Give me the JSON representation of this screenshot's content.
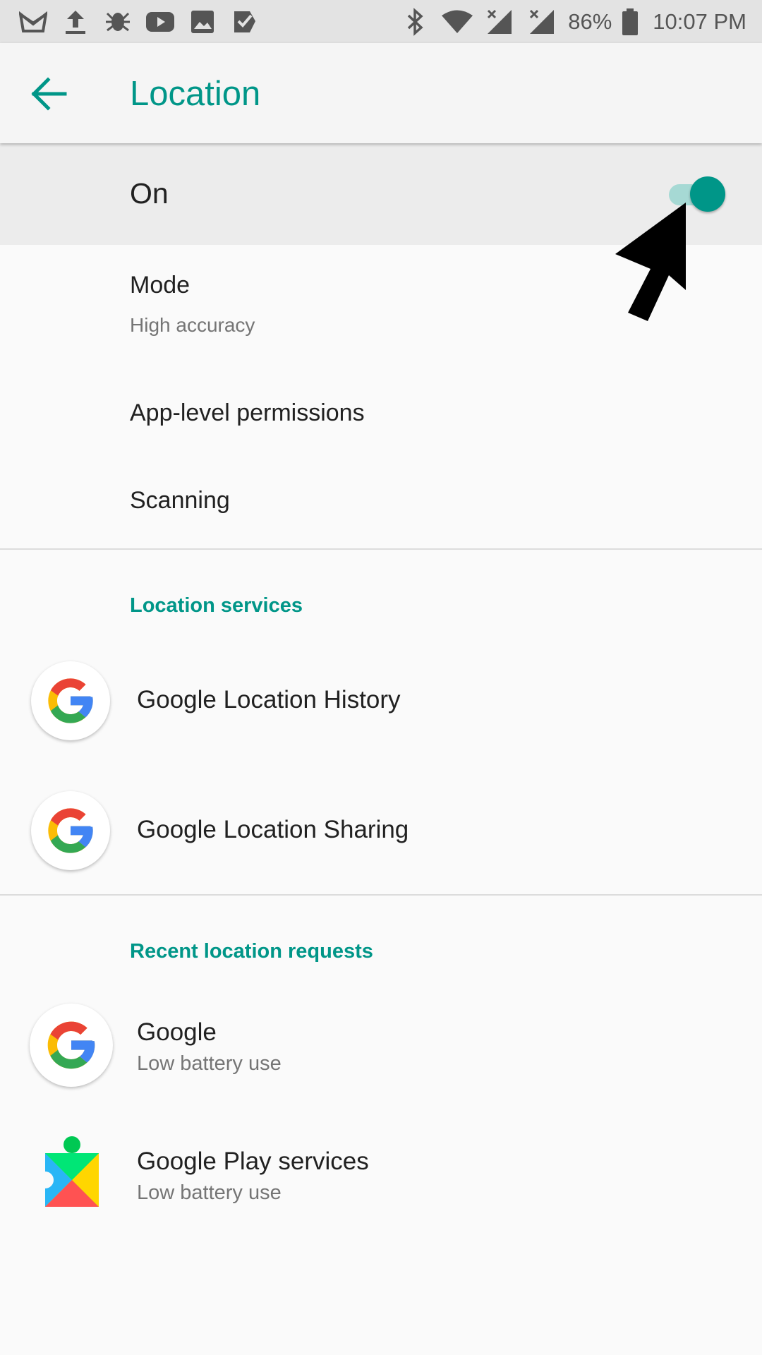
{
  "status_bar": {
    "left_icons": [
      "mail-icon",
      "upload-icon",
      "spider-icon",
      "youtube-icon",
      "image-icon",
      "tasks-icon"
    ],
    "right_icons": [
      "bluetooth-icon",
      "wifi-icon",
      "signal-icon",
      "signal-icon",
      "battery-icon"
    ],
    "battery": "86%",
    "time": "10:07 PM"
  },
  "app_bar": {
    "title": "Location",
    "back_icon": "arrow-back-icon"
  },
  "master": {
    "label": "On",
    "state": true
  },
  "settings": [
    {
      "title": "Mode",
      "subtitle": "High accuracy"
    },
    {
      "title": "App-level permissions"
    },
    {
      "title": "Scanning"
    }
  ],
  "location_services": {
    "header": "Location services",
    "items": [
      {
        "title": "Google Location History",
        "icon": "google-icon"
      },
      {
        "title": "Google Location Sharing",
        "icon": "google-icon"
      }
    ]
  },
  "recent_requests": {
    "header": "Recent location requests",
    "items": [
      {
        "title": "Google",
        "subtitle": "Low battery use",
        "icon": "google-icon"
      },
      {
        "title": "Google Play services",
        "subtitle": "Low battery use",
        "icon": "play-services-icon"
      }
    ]
  },
  "colors": {
    "accent": "#009688",
    "track": "#a6d9d4",
    "google_blue": "#4285F4",
    "google_red": "#EA4335",
    "google_yellow": "#FBBC05",
    "google_green": "#34A853"
  }
}
